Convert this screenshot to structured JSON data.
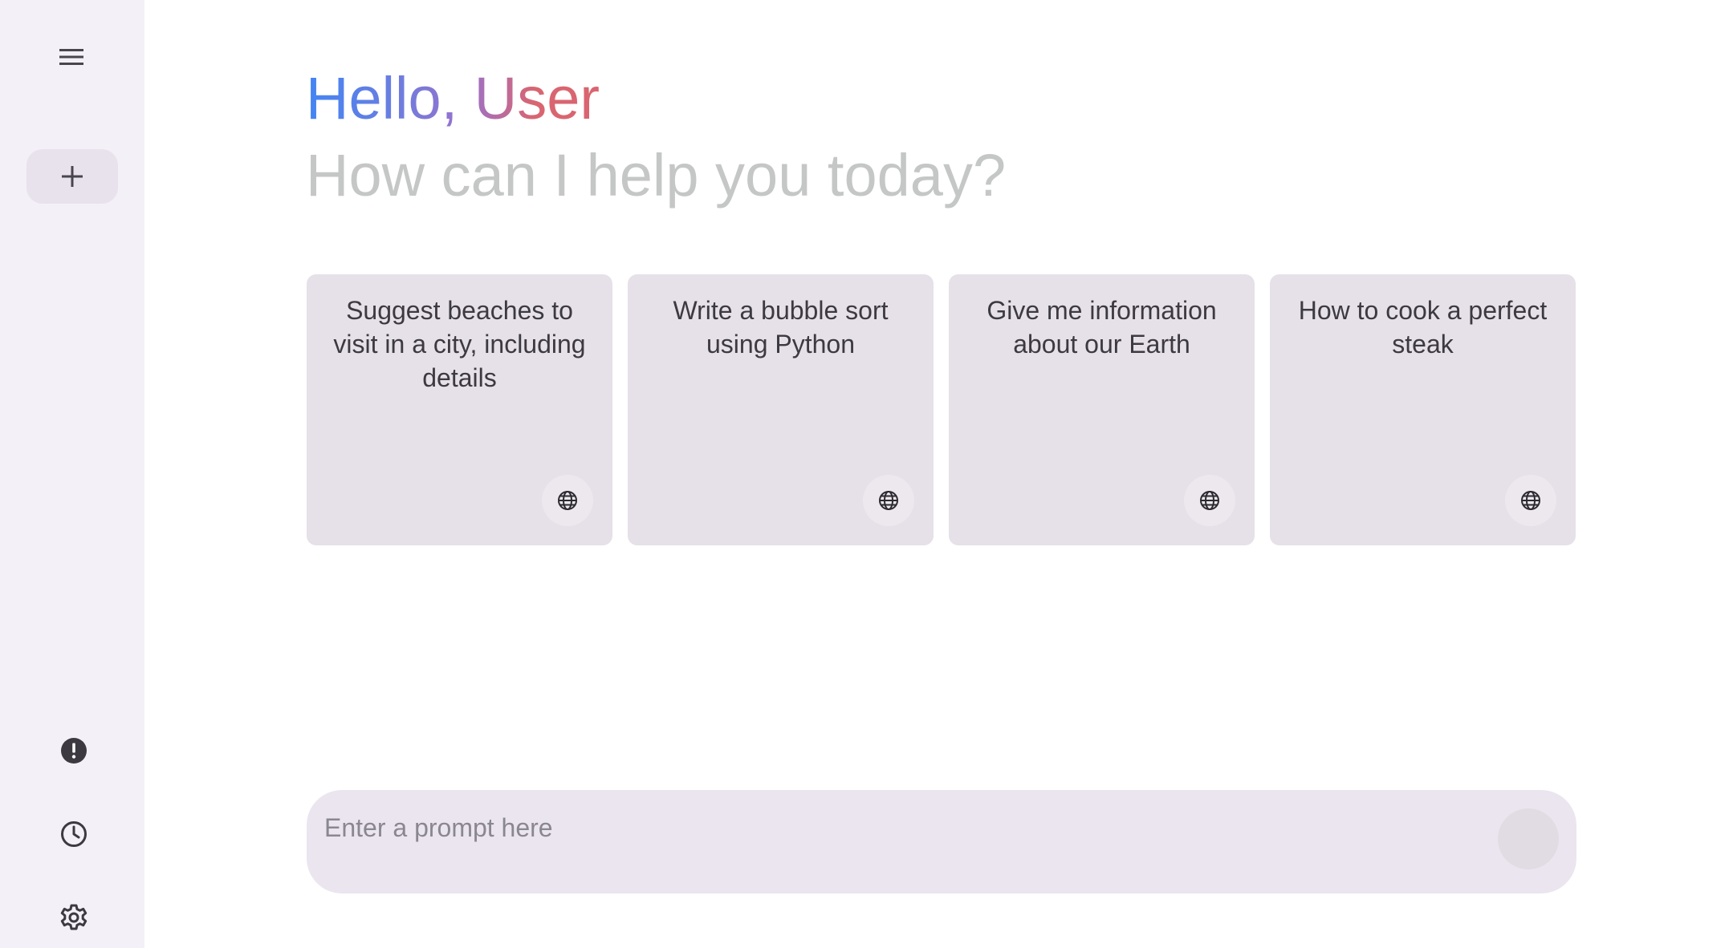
{
  "sidebar": {
    "menu_icon": "menu-icon",
    "new_chat_icon": "plus-icon",
    "bottom_icons": [
      "alert-circle-icon",
      "history-clock-icon",
      "settings-gear-icon"
    ]
  },
  "greeting": {
    "hello": "Hello, ",
    "name": "User",
    "subtitle": "How can I help you today?"
  },
  "cards": [
    {
      "text": "Suggest beaches to visit in a city, including details",
      "icon": "globe-icon"
    },
    {
      "text": "Write a bubble sort using Python",
      "icon": "globe-icon"
    },
    {
      "text": "Give me information about our Earth",
      "icon": "globe-icon"
    },
    {
      "text": "How to cook a perfect steak",
      "icon": "globe-icon"
    }
  ],
  "prompt": {
    "placeholder": "Enter a prompt here",
    "value": ""
  },
  "colors": {
    "sidebar_bg": "#f4f0f7",
    "card_bg": "#e6e0e8",
    "prompt_bg": "#ebe5ef",
    "gradient_start": "#4285f4",
    "gradient_end": "#d96570",
    "subtitle": "#c4c7c5"
  }
}
